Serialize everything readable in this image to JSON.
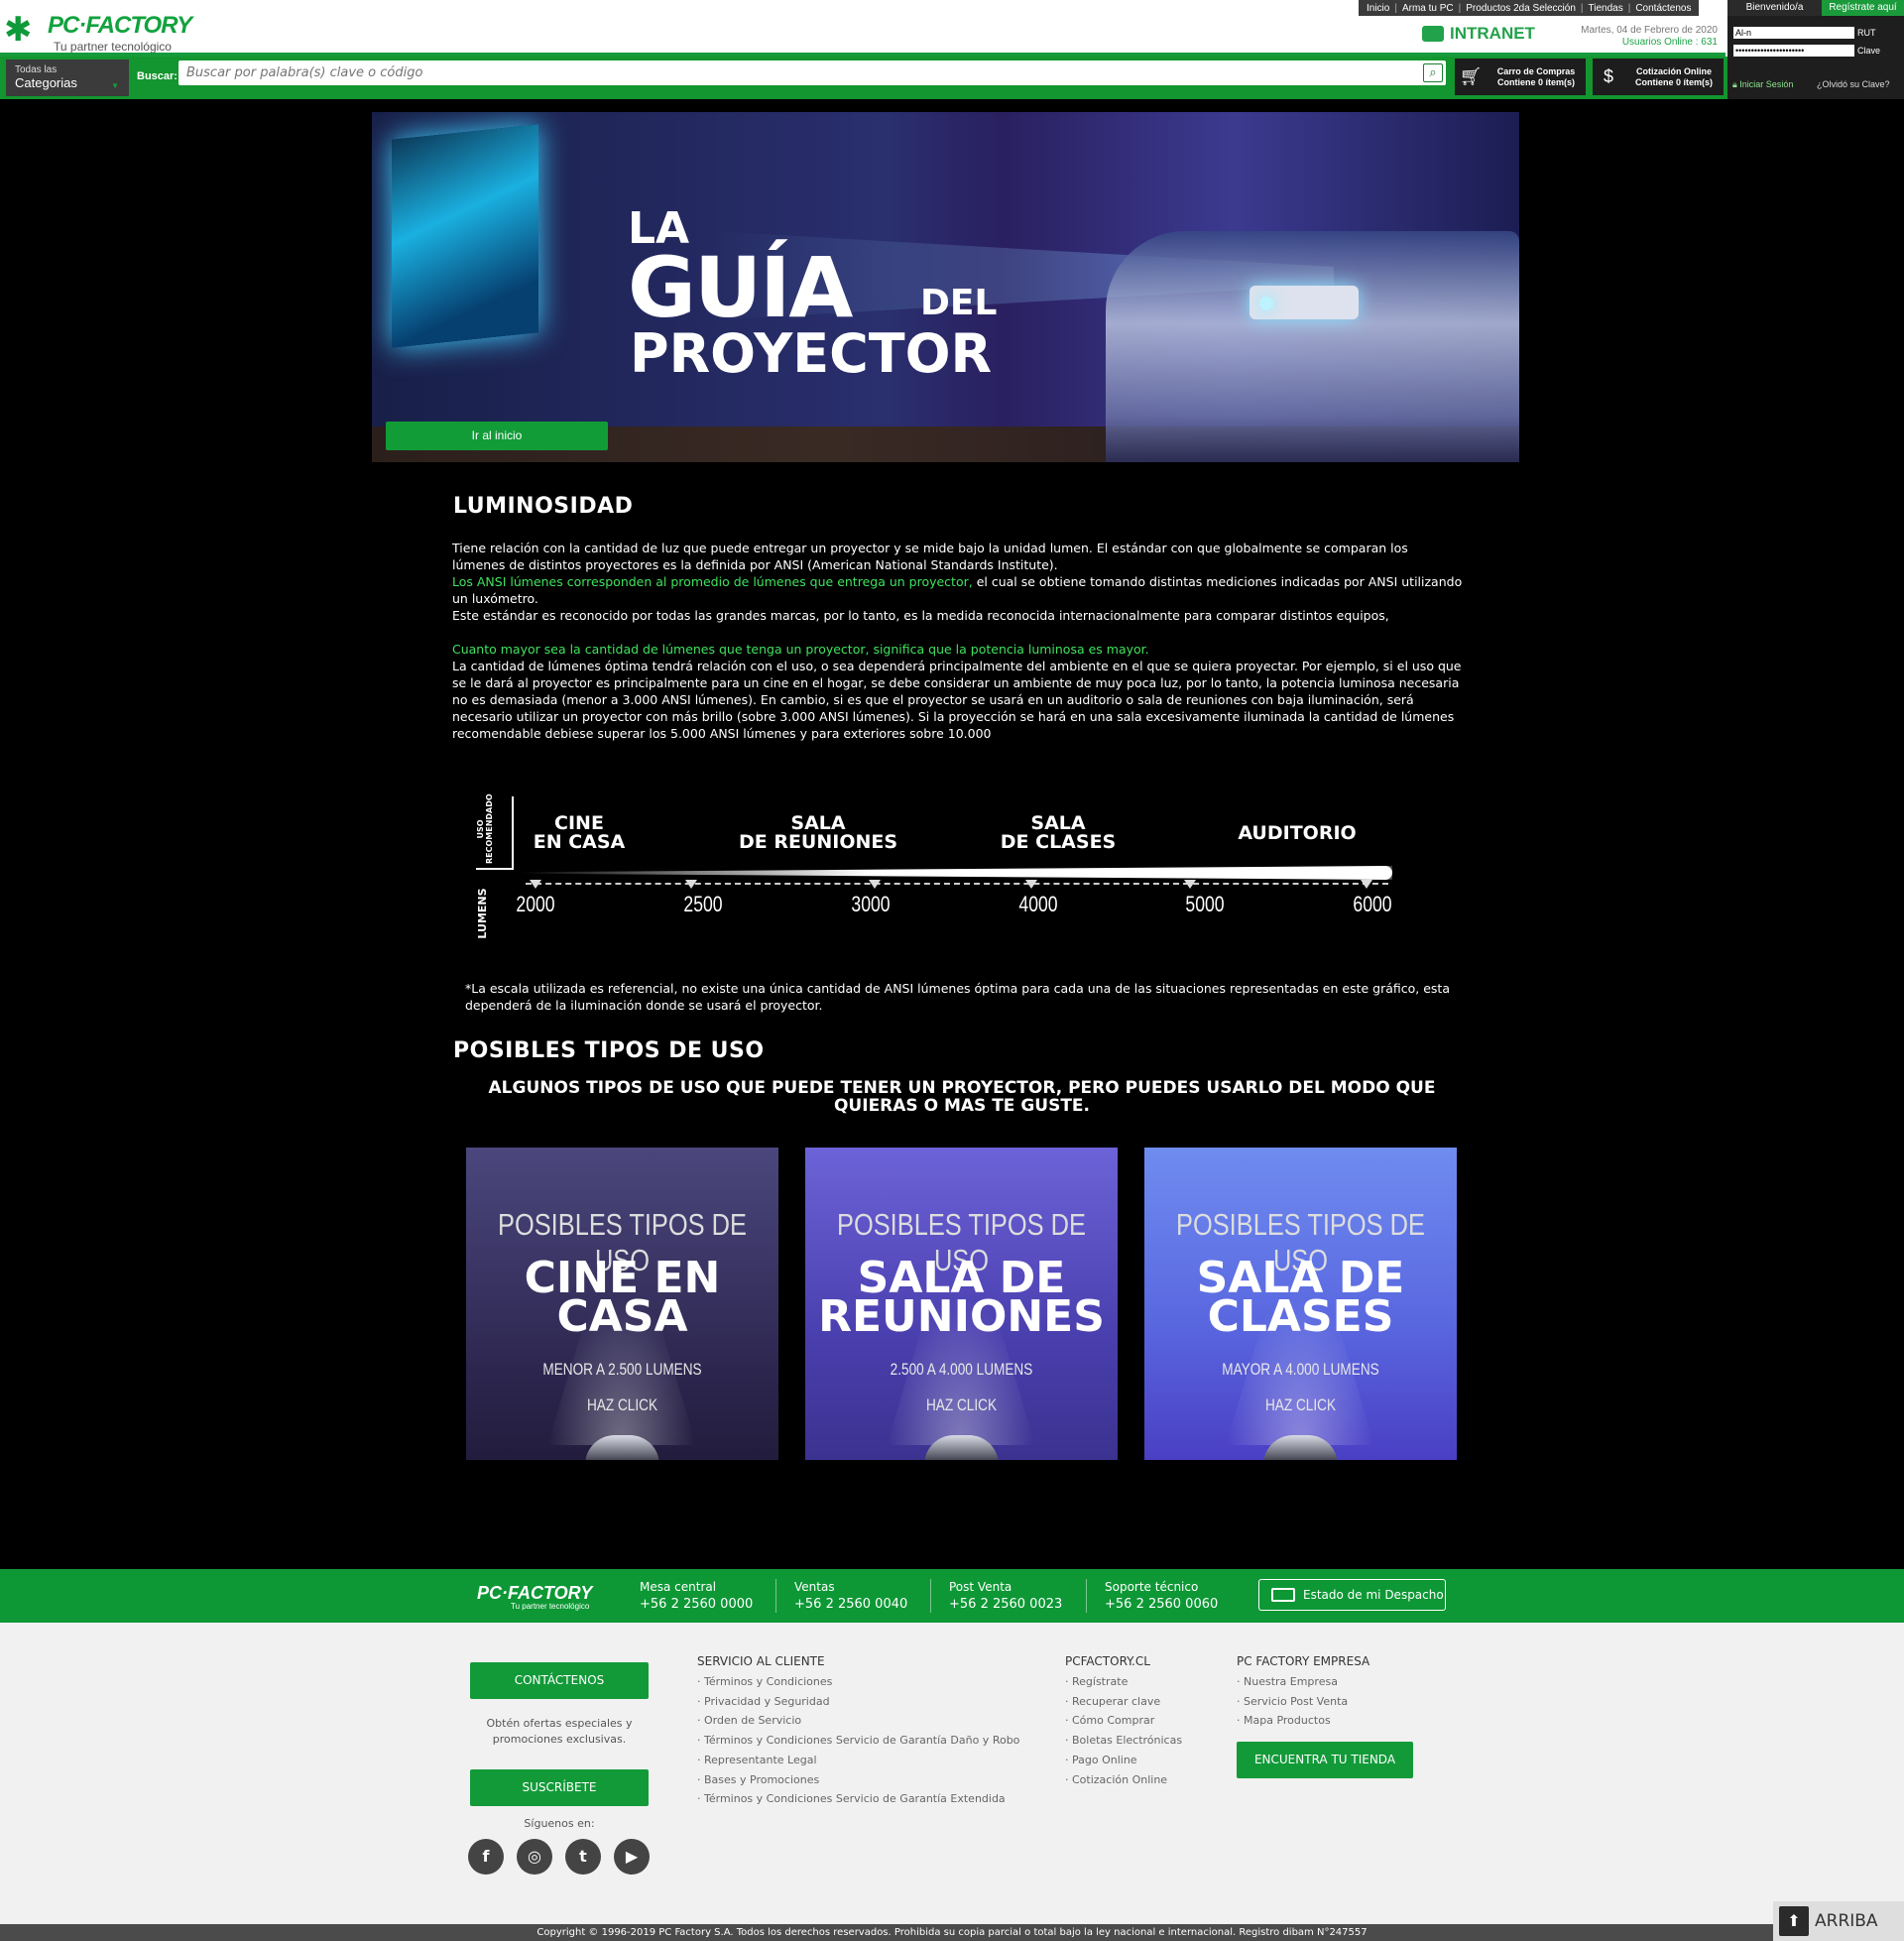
{
  "header": {
    "logo_brand": "PC·FACTORY",
    "logo_tagline": "Tu partner tecnológico",
    "top_nav": [
      "Inicio",
      "Arma tu PC",
      "Productos 2da Selección",
      "Tiendas",
      "Contáctenos"
    ],
    "intranet": "INTRANET",
    "date": "Martes, 04 de Febrero de 2020",
    "users_online": "Usuarios Online : 631",
    "welcome": "Bienvenido/a",
    "register": "Regístrate aquí",
    "rut_value": "Al-n",
    "rut_label": "RUT",
    "password_value": "••••••••••••••••••••••",
    "password_label": "Clave",
    "login": "Iniciar Sesión",
    "forgot": "¿Olvidó su Clave?",
    "categories_small": "Todas las",
    "categories_big": "Categorias",
    "search_label": "Buscar:",
    "search_placeholder": "Buscar por palabra(s) clave o código",
    "cart_title": "Carro de Compras",
    "cart_sub": "Contiene 0 ítem(s)",
    "quote_title": "Cotización Online",
    "quote_sub": "Contiene 0 ítem(s)"
  },
  "banner": {
    "line1": "LA",
    "line2": "GUÍA",
    "line3": "DEL",
    "line4": "PROYECTOR",
    "home_button": "Ir al inicio"
  },
  "luminosidad": {
    "title": "LUMINOSIDAD",
    "p1": "Tiene relación con la cantidad de luz que puede entregar un proyector y se mide bajo la unidad lumen. El estándar con que globalmente se comparan los lúmenes de distintos proyectores es la definida por ANSI (American National Standards Institute).",
    "p2_green": "Los ANSI lúmenes corresponden al promedio de lúmenes que entrega un proyector,",
    "p2_rest": " el cual se obtiene tomando distintas mediciones indicadas por ANSI utilizando un luxómetro.",
    "p3": "Este estándar es reconocido por todas las grandes marcas, por lo tanto, es la medida reconocida internacionalmente para comparar distintos equipos,",
    "p4_green": "Cuanto mayor sea la cantidad de lúmenes que tenga un proyector, significa que la potencia luminosa es mayor.",
    "p5": "La cantidad de lúmenes óptima tendrá relación con el uso, o sea dependerá principalmente del ambiente en el que se quiera proyectar. Por ejemplo, si el uso que se le dará al proyector es principalmente para un cine en el hogar, se debe considerar un ambiente de muy poca luz, por lo tanto, la potencia luminosa necesaria no es demasiada (menor a 3.000 ANSI lúmenes). En cambio, si es que el proyector se usará en un auditorio o sala de reuniones con baja iluminación, será necesario utilizar un proyector con más brillo (sobre 3.000 ANSI lúmenes). Si la proyección se hará en una sala excesivamente iluminada la cantidad de lúmenes recomendable debiese superar los 5.000 ANSI lúmenes y para exteriores sobre 10.000"
  },
  "scale": {
    "uso_label": "USO RECOMENDADO",
    "lumens_label": "LUMENS",
    "uses": [
      {
        "line1": "CINE",
        "line2": "EN CASA"
      },
      {
        "line1": "SALA",
        "line2": "DE REUNIONES"
      },
      {
        "line1": "SALA",
        "line2": "DE CLASES"
      },
      {
        "line1": "AUDITORIO",
        "line2": ""
      }
    ],
    "ticks": [
      "2000",
      "2500",
      "3000",
      "4000",
      "5000",
      "6000"
    ],
    "note": "*La escala utilizada es referencial, no existe una única cantidad de ANSI lúmenes óptima para cada una de las situaciones representadas en este gráfico, esta dependerá de la iluminación donde se usará el proyector."
  },
  "tipos": {
    "title": "POSIBLES TIPOS DE USO",
    "subtitle": "ALGUNOS TIPOS DE USO QUE PUEDE TENER UN PROYECTOR, PERO PUEDES USARLO DEL MODO QUE QUIERAS O MAS TE GUSTE.",
    "cards": [
      {
        "top": "POSIBLES TIPOS DE USO",
        "line1": "CINE EN",
        "line2": "CASA",
        "range": "MENOR A 2.500 LUMENS",
        "cta": "HAZ CLICK",
        "color": "#3d3668"
      },
      {
        "top": "POSIBLES TIPOS DE USO",
        "line1": "SALA DE",
        "line2": "REUNIONES",
        "range": "2.500 A 4.000 LUMENS",
        "cta": "HAZ CLICK",
        "color": "#5a4bb8"
      },
      {
        "top": "POSIBLES TIPOS DE USO",
        "line1": "SALA DE",
        "line2": "CLASES",
        "range": "MAYOR A 4.000 LUMENS",
        "cta": "HAZ CLICK",
        "color": "#5a62d8"
      }
    ]
  },
  "footer": {
    "logo": "PC·FACTORY",
    "tagline": "Tu partner tecnológico",
    "phones": [
      {
        "label": "Mesa central",
        "number": "+56 2 2560 0000"
      },
      {
        "label": "Ventas",
        "number": "+56 2 2560 0040"
      },
      {
        "label": "Post Venta",
        "number": "+56 2 2560 0023"
      },
      {
        "label": "Soporte técnico",
        "number": "+56 2 2560 0060"
      }
    ],
    "estado": "Estado de mi Despacho",
    "contact_button": "CONTÁCTENOS",
    "promo_text": "Obtén ofertas especiales y promociones exclusivas.",
    "subscribe_button": "SUSCRÍBETE",
    "follow": "Síguenos en:",
    "col1_title": "SERVICIO AL CLIENTE",
    "col1": [
      "Términos y Condiciones",
      "Privacidad y Seguridad",
      "Orden de Servicio",
      "Términos y Condiciones Servicio de Garantía Daño y Robo",
      "Representante Legal",
      "Bases y Promociones",
      "Términos y Condiciones Servicio de Garantía Extendida"
    ],
    "col2_title": "PCFACTORY.CL",
    "col2": [
      "Regístrate",
      "Recuperar clave",
      "Cómo Comprar",
      "Boletas Electrónicas",
      "Pago Online",
      "Cotización Online"
    ],
    "col3_title": "PC FACTORY EMPRESA",
    "col3": [
      "Nuestra Empresa",
      "Servicio Post Venta",
      "Mapa Productos"
    ],
    "store_button": "ENCUENTRA TU TIENDA",
    "copyright": "Copyright © 1996-2019 PC Factory S.A. Todos los derechos reservados. Prohibida su copia parcial o total bajo la ley nacional e internacional. Registro dibam N°247557",
    "arriba": "ARRIBA"
  }
}
